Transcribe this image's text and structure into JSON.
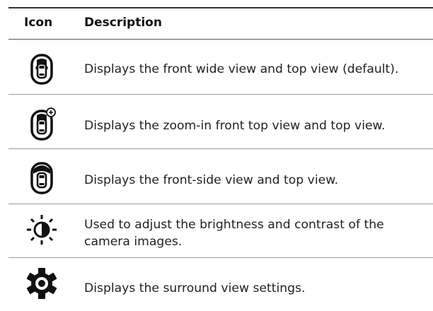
{
  "table": {
    "headers": {
      "icon": "Icon",
      "description": "Description"
    },
    "rows": [
      {
        "icon": "front-wide-view-icon",
        "description": "Displays the front wide view and top view (default)."
      },
      {
        "icon": "zoom-in-front-view-icon",
        "description": "Displays the zoom-in front top view and top view."
      },
      {
        "icon": "front-side-view-icon",
        "description": "Displays the front-side view and top view."
      },
      {
        "icon": "brightness-contrast-icon",
        "description": "Used to adjust the brightness and contrast of the camera images."
      },
      {
        "icon": "settings-gear-icon",
        "description": "Displays the surround view settings."
      }
    ]
  }
}
